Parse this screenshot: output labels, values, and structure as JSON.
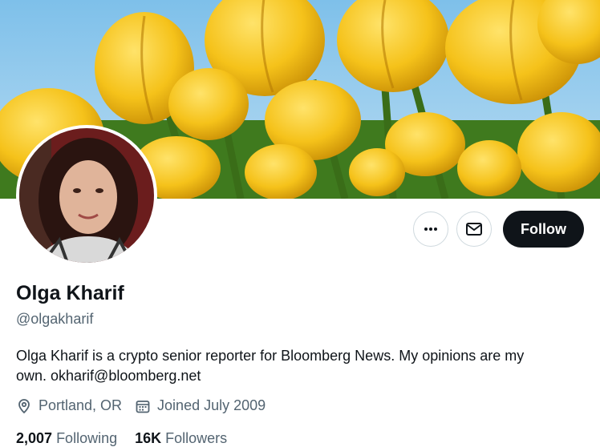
{
  "profile": {
    "name": "Olga Kharif",
    "handle": "@olgakharif",
    "bio_line1": "Olga Kharif is a crypto senior reporter for Bloomberg News. My opinions are my",
    "bio_line2": "own. okharif@bloomberg.net",
    "location": "Portland, OR",
    "joined": "Joined July 2009"
  },
  "actions": {
    "more_icon": "more-horizontal-icon",
    "message_icon": "envelope-icon",
    "follow_label": "Follow"
  },
  "stats": {
    "following_count": "2,007",
    "following_label": "Following",
    "followers_count": "16K",
    "followers_label": "Followers"
  },
  "colors": {
    "text_primary": "#0f1419",
    "text_secondary": "#536471",
    "follow_bg": "#0f1419",
    "border": "#cfd9de"
  }
}
